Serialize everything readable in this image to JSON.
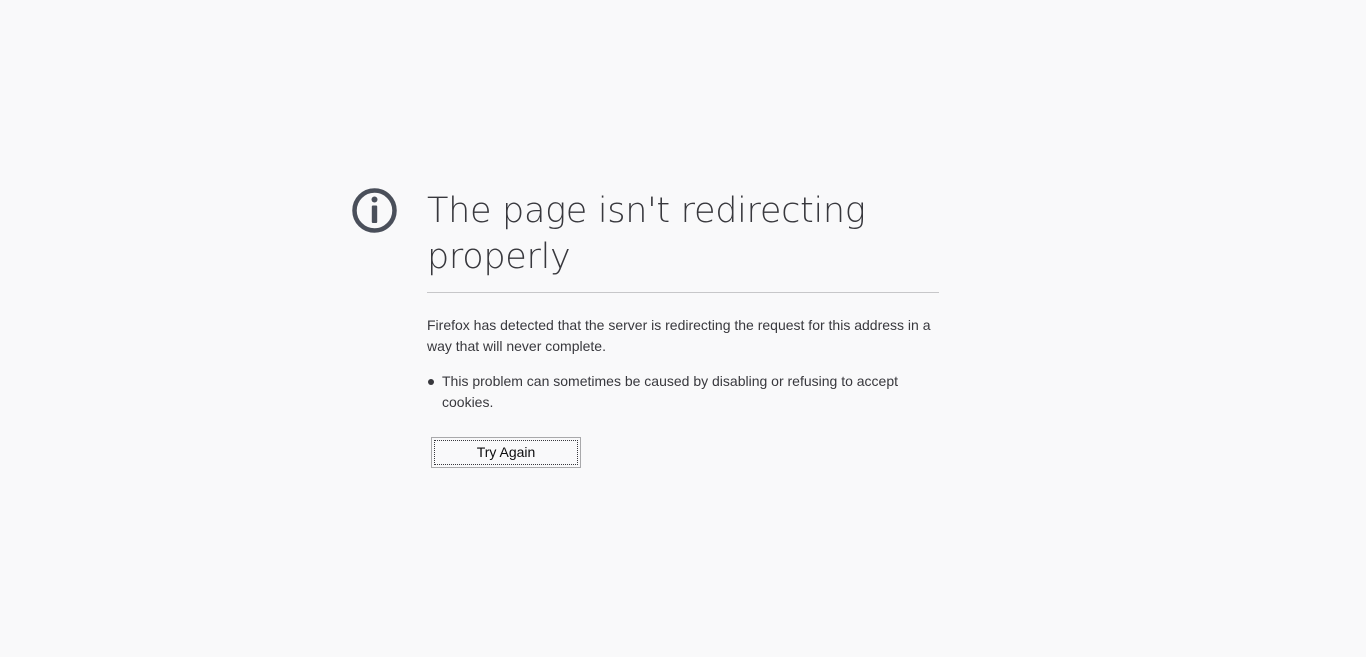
{
  "error": {
    "icon": "info-icon",
    "title": "The page isn't redirecting properly",
    "description": "Firefox has detected that the server is redirecting the request for this address in a way that will never complete.",
    "hints": [
      "This problem can sometimes be caused by disabling or refusing to accept cookies."
    ],
    "try_again_label": "Try Again"
  },
  "colors": {
    "background": "#f9f9fa",
    "text": "#38383d",
    "icon": "#4a4f5a",
    "divider": "#c7c7c9"
  }
}
